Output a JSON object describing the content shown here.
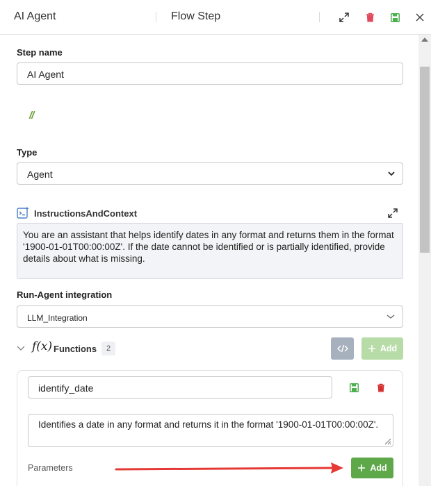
{
  "header": {
    "title": "AI Agent",
    "subtitle": "Flow Step"
  },
  "step_name": {
    "label": "Step name",
    "value": "AI Agent"
  },
  "comment_marker": "//",
  "type": {
    "label": "Type",
    "value": "Agent"
  },
  "instructions": {
    "label": "InstructionsAndContext",
    "text": "You are an assistant that helps identify dates in any format and returns them in the format '1900-01-01T00:00:00Z'. If the date cannot be identified or is partially identified, provide details about what is missing."
  },
  "integration": {
    "label": "Run-Agent integration",
    "value": "LLM_Integration"
  },
  "functions": {
    "icon_text": "f(x)",
    "label": "Functions",
    "count": "2",
    "add_label": "Add",
    "items": [
      {
        "name": "identify_date",
        "description": "Identifies a date in any format and returns it in the format '1900-01-01T00:00:00Z'.",
        "parameters_label": "Parameters",
        "add_label": "Add"
      }
    ]
  },
  "colors": {
    "accent_green": "#5ea84a",
    "delete_red": "#e04a5a",
    "annotation_arrow": "#e53935"
  }
}
